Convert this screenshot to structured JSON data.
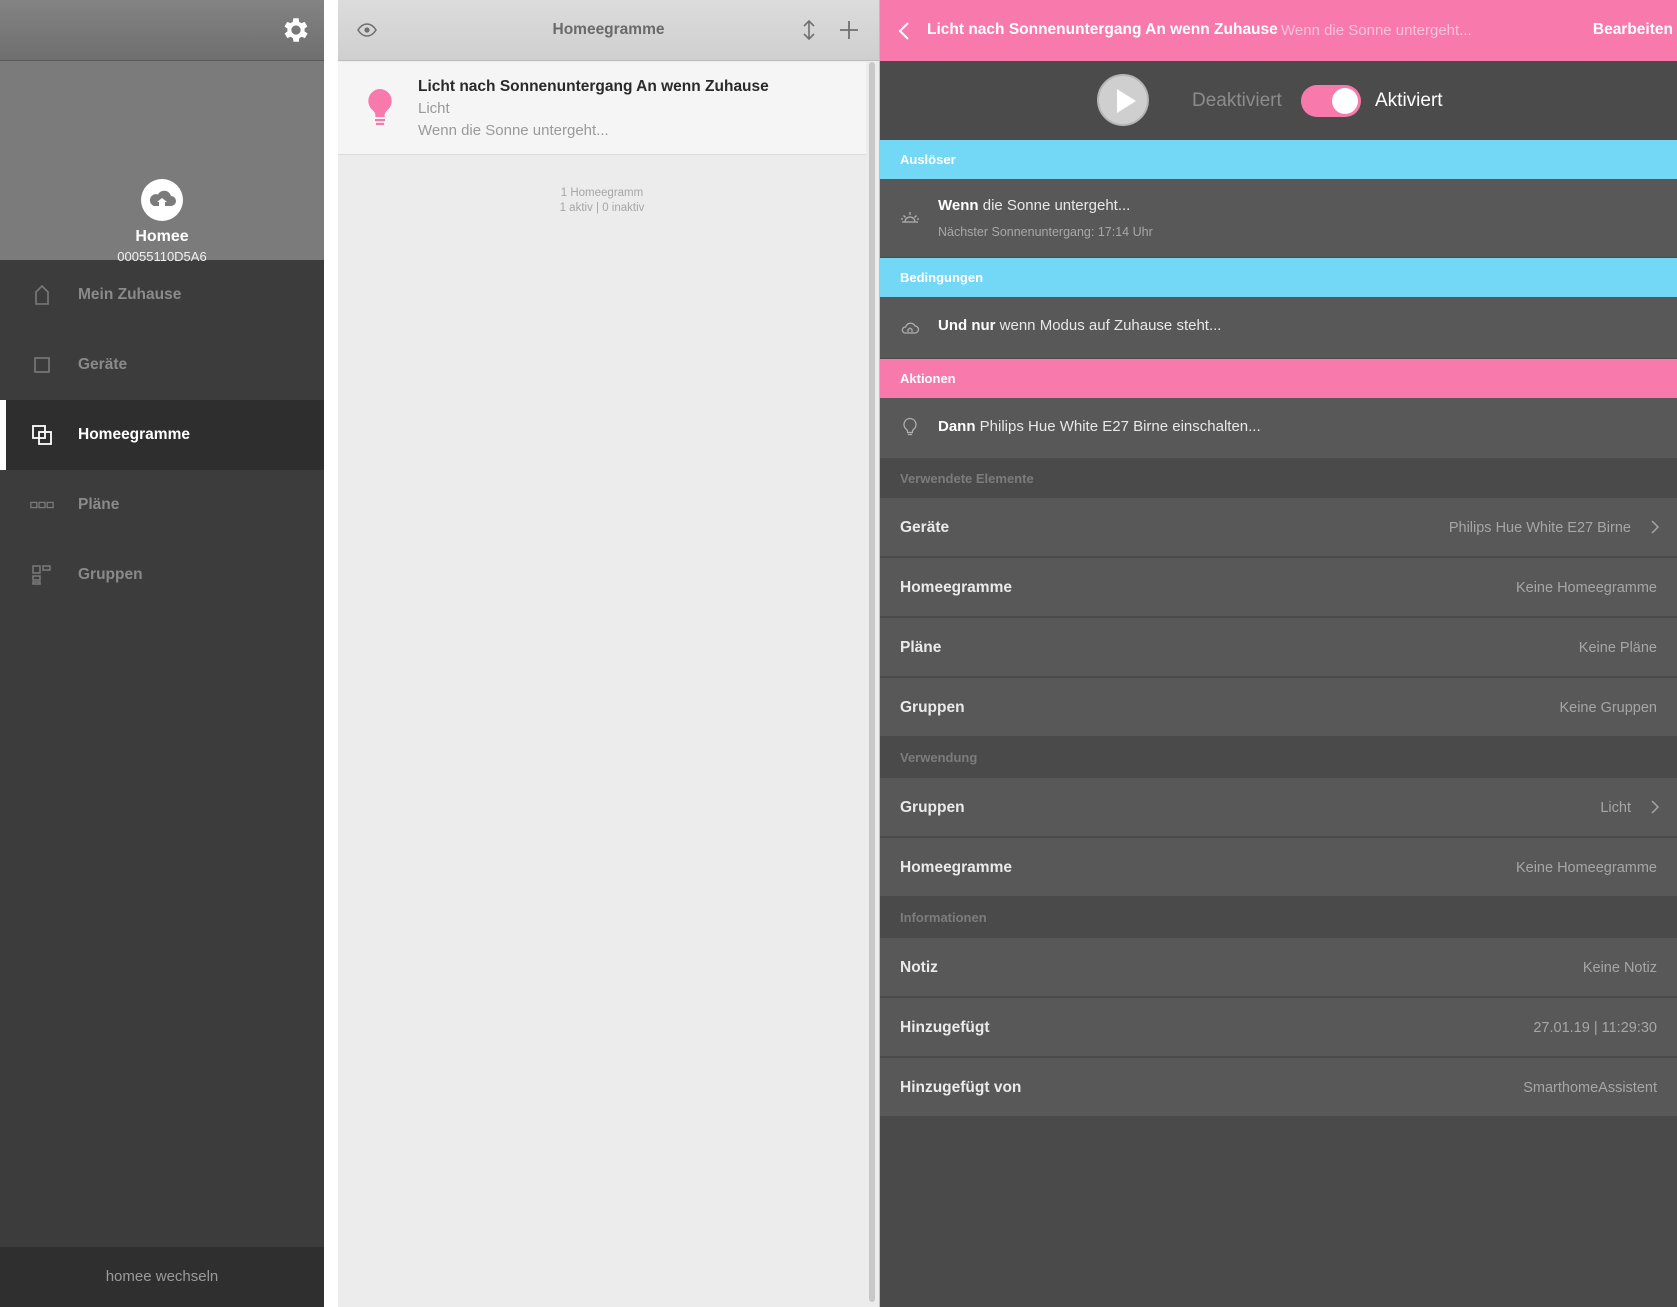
{
  "sidebar": {
    "settings_icon": "gear-icon",
    "hub": {
      "name": "Homee",
      "id": "00055110D5A6",
      "icon": "cloud-icon"
    },
    "items": [
      {
        "label": "Mein Zuhause",
        "icon": "home-icon",
        "active": false
      },
      {
        "label": "Geräte",
        "icon": "square-icon",
        "active": false
      },
      {
        "label": "Homeegramme",
        "icon": "homeegram-icon",
        "active": true
      },
      {
        "label": "Pläne",
        "icon": "plans-icon",
        "active": false
      },
      {
        "label": "Gruppen",
        "icon": "groups-icon",
        "active": false
      }
    ],
    "switch_label": "homee wechseln"
  },
  "middle": {
    "title": "Homeegramme",
    "items": [
      {
        "title": "Licht nach Sonnenuntergang An wenn Zuhause",
        "category": "Licht",
        "description": "Wenn die Sonne untergeht...",
        "icon": "lightbulb-icon"
      }
    ],
    "summary_count": "1 Homeegramm",
    "summary_state": "1 aktiv | 0 inaktiv"
  },
  "detail": {
    "title": "Licht nach Sonnenuntergang An wenn Zuhause",
    "subtitle": "Wenn die Sonne untergeht...",
    "edit_label": "Bearbeiten",
    "toggle": {
      "off_label": "Deaktiviert",
      "on_label": "Aktiviert",
      "enabled": true
    },
    "sections": {
      "trigger": "Auslöser",
      "conditions": "Bedingungen",
      "actions": "Aktionen",
      "used_elements": "Verwendete Elemente",
      "usage": "Verwendung",
      "info": "Informationen"
    },
    "trigger": {
      "prefix": "Wenn",
      "text": " die Sonne untergeht...",
      "sub": "Nächster Sonnenuntergang: 17:14 Uhr",
      "icon": "sunset-icon"
    },
    "condition": {
      "prefix": "Und nur",
      "text": " wenn Modus auf Zuhause steht...",
      "icon": "cloud-home-icon"
    },
    "action": {
      "prefix": "Dann",
      "text": " Philips Hue White E27 Birne einschalten...",
      "icon": "lightbulb-icon"
    },
    "used_elements": [
      {
        "key": "Geräte",
        "value": "Philips Hue White E27 Birne",
        "link": true
      },
      {
        "key": "Homeegramme",
        "value": "Keine Homeegramme",
        "link": false
      },
      {
        "key": "Pläne",
        "value": "Keine Pläne",
        "link": false
      },
      {
        "key": "Gruppen",
        "value": "Keine Gruppen",
        "link": false
      }
    ],
    "usage": [
      {
        "key": "Gruppen",
        "value": "Licht",
        "link": true
      },
      {
        "key": "Homeegramme",
        "value": "Keine Homeegramme",
        "link": false
      }
    ],
    "info": [
      {
        "key": "Notiz",
        "value": "Keine Notiz"
      },
      {
        "key": "Hinzugefügt",
        "value": "27.01.19 | 11:29:30"
      },
      {
        "key": "Hinzugefügt von",
        "value": "SmarthomeAssistent"
      }
    ]
  },
  "colors": {
    "accent_pink": "#f879ac",
    "accent_blue": "#72d8f5",
    "sidebar_bg": "#3c3c3c",
    "detail_bg": "#4a4a4a"
  }
}
